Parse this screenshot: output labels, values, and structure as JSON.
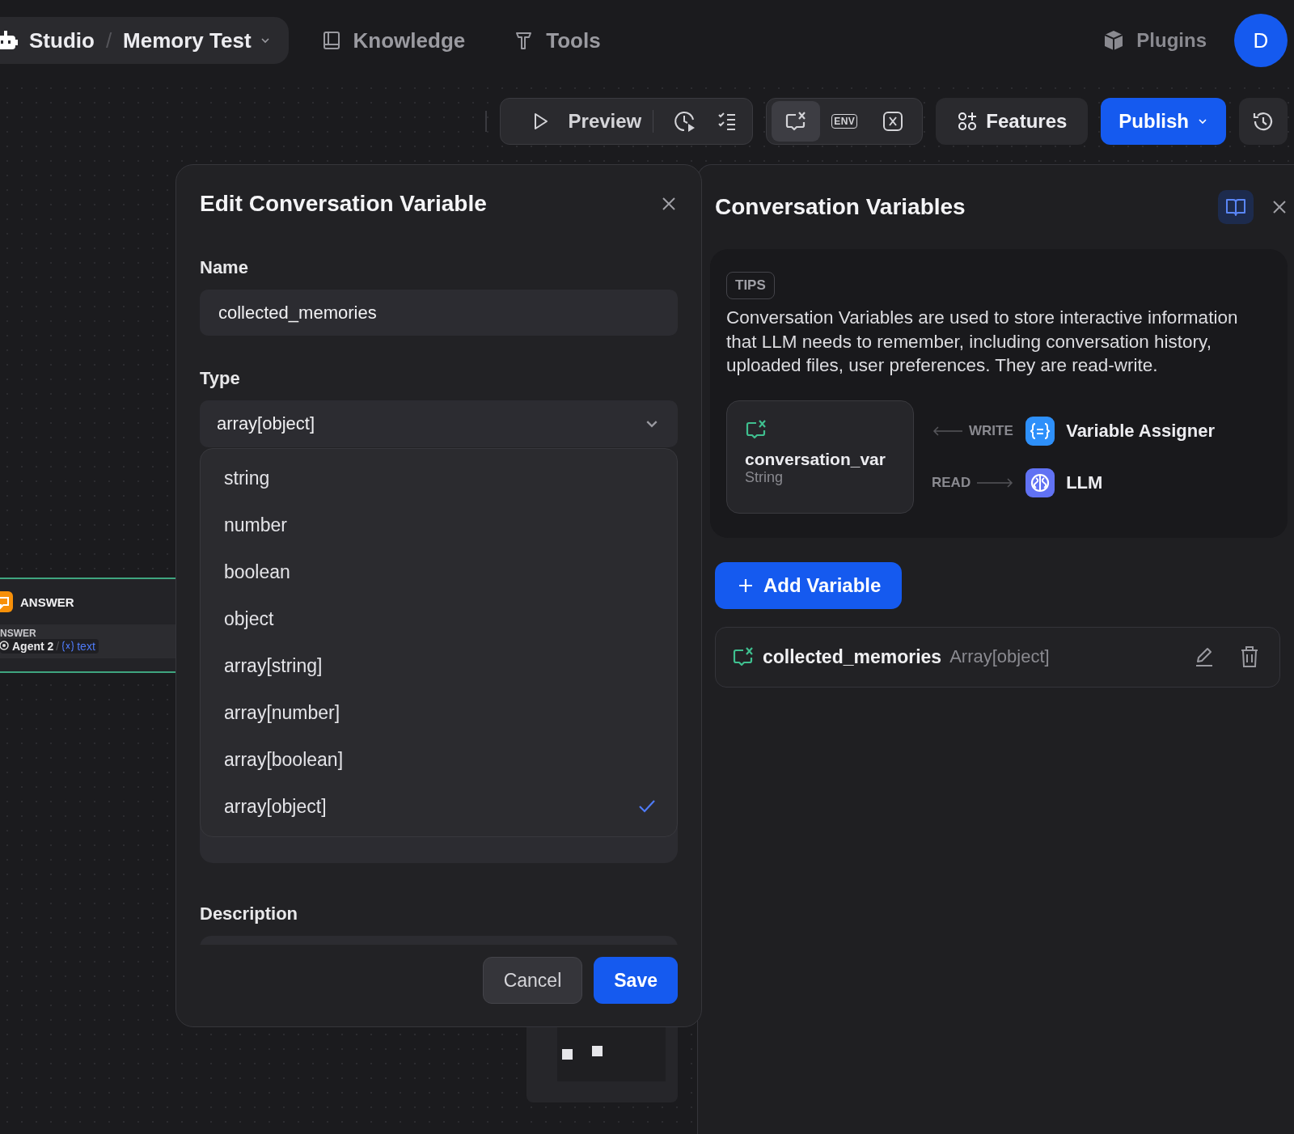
{
  "nav": {
    "app": "Studio",
    "separator": "/",
    "project": "Memory Test",
    "links": [
      {
        "label": "Knowledge",
        "kind": "knowledge"
      },
      {
        "label": "Tools",
        "kind": "tools"
      }
    ],
    "plugins": "Plugins",
    "avatar": "D"
  },
  "toolbar": {
    "preview": "Preview",
    "features": "Features",
    "publish": "Publish",
    "env_buttons": [
      {
        "kind": "conversation",
        "selected": true
      },
      {
        "kind": "env",
        "label": "ENV",
        "selected": false
      },
      {
        "kind": "variable",
        "selected": false
      }
    ]
  },
  "canvas": {
    "node": {
      "title": "ANSWER",
      "field": "NSWER",
      "source": "Agent 2",
      "separator": "/",
      "variable": "text"
    }
  },
  "modal": {
    "title": "Edit Conversation Variable",
    "name_label": "Name",
    "name_value": "collected_memories",
    "type_label": "Type",
    "type_value": "array[object]",
    "type_options": [
      {
        "label": "string",
        "selected": false
      },
      {
        "label": "number",
        "selected": false
      },
      {
        "label": "boolean",
        "selected": false
      },
      {
        "label": "object",
        "selected": false
      },
      {
        "label": "array[string]",
        "selected": false
      },
      {
        "label": "array[number]",
        "selected": false
      },
      {
        "label": "array[boolean]",
        "selected": false
      },
      {
        "label": "array[object]",
        "selected": true
      }
    ],
    "description_label": "Description",
    "buttons": [
      {
        "label": "Cancel",
        "kind": "secondary"
      },
      {
        "label": "Save",
        "kind": "primary"
      }
    ]
  },
  "panel": {
    "title": "Conversation Variables",
    "tips_badge": "TIPS",
    "tips_text": "Conversation Variables are used to store interactive information that LLM needs to remember, including conversation history, uploaded files, user preferences. They are read-write.",
    "example": {
      "name": "conversation_var",
      "type": "String",
      "links": [
        {
          "kind": "write",
          "label": "WRITE",
          "target": "Variable Assigner"
        },
        {
          "kind": "read",
          "label": "READ",
          "target": "LLM"
        }
      ]
    },
    "add_button": "Add Variable",
    "variables": [
      {
        "name": "collected_memories",
        "type": "Array[object]"
      }
    ]
  }
}
